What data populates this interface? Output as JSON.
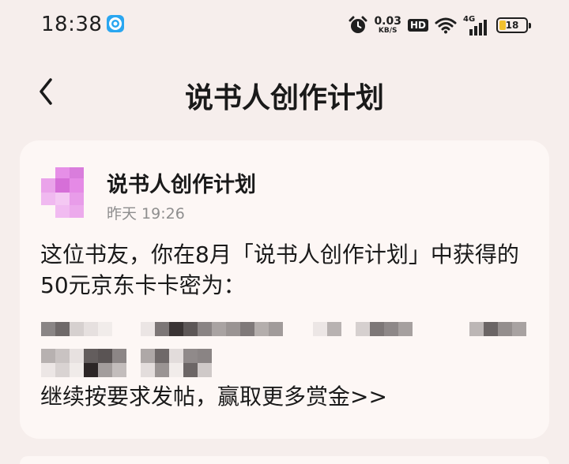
{
  "status_bar": {
    "time": "18:38",
    "net_speed_value": "0.03",
    "net_speed_unit": "KB/S",
    "hd_label": "HD",
    "network_label": "4G",
    "battery_percent": "18",
    "icons": [
      "app-notification-icon",
      "alarm-icon",
      "wifi-icon",
      "cell-signal-icon",
      "battery-icon"
    ]
  },
  "nav": {
    "back_icon": "chevron-left-icon",
    "title": "说书人创作计划"
  },
  "message": {
    "sender": "说书人创作计划",
    "time": "昨天 19:26",
    "body": "这位书友，你在8月「说书人创作计划」中获得的50元京东卡卡密为：",
    "redacted_note": "",
    "link_text": "继续按要求发帖，赢取更多赏金>>"
  },
  "colors": {
    "background": "#f6eeec",
    "card": "#fdf7f5",
    "text": "#1a1a1a",
    "muted": "#8e8e8e",
    "battery_fill": "#f2c12e",
    "avatar": "#e58ae6"
  }
}
